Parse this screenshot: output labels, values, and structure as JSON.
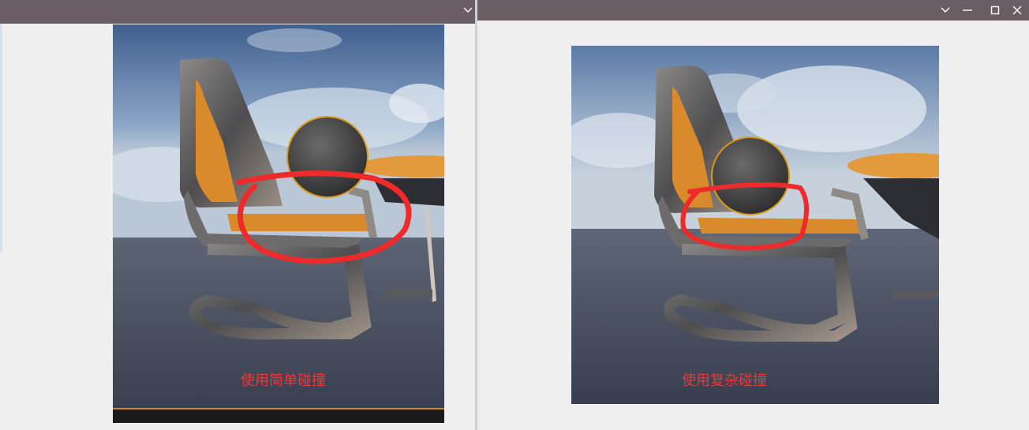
{
  "left_window": {
    "caption": "使用简单碰撞",
    "titlebar_buttons": [
      "chevron-down-icon"
    ]
  },
  "right_window": {
    "caption": "使用复杂碰撞",
    "titlebar_buttons": [
      "chevron-down-icon",
      "minimize-icon",
      "maximize-icon",
      "close-icon"
    ]
  },
  "colors": {
    "titlebar": "#6a5d63",
    "window_bg": "#efefef",
    "caption_text": "#e9383a",
    "annotation_circle": "#ee2a2a",
    "seat_orange": "#d98a2a"
  }
}
